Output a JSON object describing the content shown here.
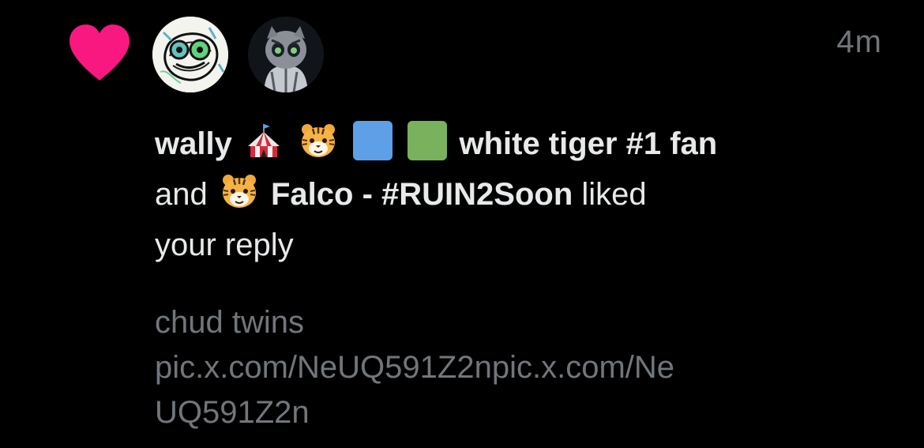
{
  "notification": {
    "type_icon": "heart-icon",
    "accent_color": "#f91880",
    "timestamp": "4m",
    "users": [
      {
        "display_name": "wally",
        "emojis": [
          "circus-tent-emoji",
          "tiger-face-emoji"
        ],
        "squares": [
          "#5da0e8",
          "#79b15d"
        ],
        "name_suffix": "white tiger #1 fan",
        "avatar": "avatar-scribble-creature"
      },
      {
        "display_name": "Falco - #RUIN2Soon",
        "emojis": [
          "tiger-face-emoji"
        ],
        "avatar": "avatar-dark-creature"
      }
    ],
    "connector": "and",
    "action_text": "liked",
    "object_text": "your reply",
    "preview_lines": [
      "chud twins",
      "pic.x.com/NeUQ591Z2npic.x.com/Ne",
      "UQ591Z2n"
    ]
  }
}
